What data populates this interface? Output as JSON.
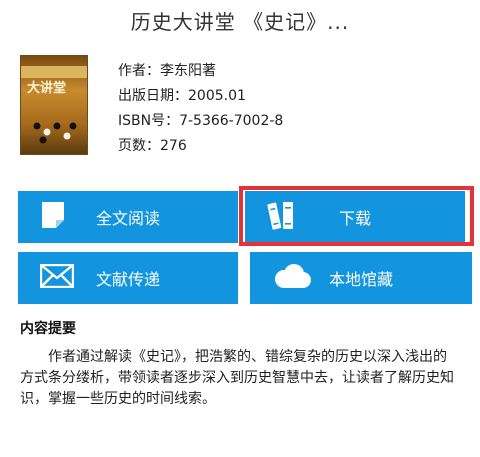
{
  "header": {
    "title": "历史大讲堂 《史记》..."
  },
  "book": {
    "cover": {
      "title_text": "大讲堂"
    },
    "author_line": "作者：李东阳著",
    "publish_date_line": "出版日期：2005.01",
    "isbn_line": "ISBN号：7-5366-7002-8",
    "pages_line": "页数：276"
  },
  "actions": {
    "fulltext_label": "全文阅读",
    "download_label": "下载",
    "docdeliver_label": "文献传递",
    "local_label": "本地馆藏"
  },
  "summary": {
    "heading": "内容提要",
    "text": "作者通过解读《史记》，把浩繁的、错综复杂的历史以深入浅出的方式条分缕析，带领读者逐步深入到历史智慧中去，让读者了解历史知识，掌握一些历史的时间线索。"
  },
  "colors": {
    "button_blue": "#1295de",
    "highlight_red": "#e2333b"
  },
  "icons": {
    "fulltext": "document-icon",
    "download": "books-icon",
    "docdeliver": "envelope-icon",
    "local": "cloud-icon"
  }
}
